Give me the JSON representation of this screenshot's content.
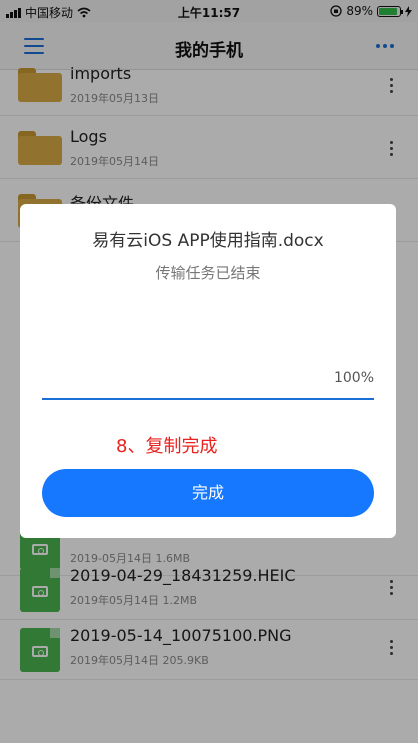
{
  "status_bar": {
    "carrier": "中国移动",
    "time": "上午11:57",
    "battery_percent": "89%",
    "battery_level": 0.89,
    "icons": [
      "signal-bars-icon",
      "wifi-icon",
      "orientation-lock-icon",
      "battery-icon",
      "charging-icon"
    ]
  },
  "nav": {
    "title": "我的手机",
    "left_icon": "menu-icon",
    "right_icon": "more-icon"
  },
  "files": [
    {
      "name": "imports",
      "meta": "2019年05月13日",
      "type": "folder"
    },
    {
      "name": "Logs",
      "meta": "2019年05月14日",
      "type": "folder"
    },
    {
      "name": "备份文件",
      "meta": "",
      "type": "folder"
    },
    {
      "name": "",
      "meta": "2019-05月14日  1.6MB",
      "type": "image"
    },
    {
      "name": "2019-04-29_18431259.HEIC",
      "meta": "2019年05月14日  1.2MB",
      "type": "image"
    },
    {
      "name": "2019-05-14_10075100.PNG",
      "meta": "2019年05月14日  205.9KB",
      "type": "image"
    }
  ],
  "dialog": {
    "title": "易有云iOS APP使用指南.docx",
    "subtitle": "传输任务已结束",
    "progress_text": "100%",
    "progress_value": 1.0,
    "annotation": "8、复制完成",
    "done_label": "完成"
  },
  "colors": {
    "accent": "#1677ff",
    "annotation": "#e8231f",
    "folder": "#d8ab45",
    "image_file": "#4bb54f"
  }
}
